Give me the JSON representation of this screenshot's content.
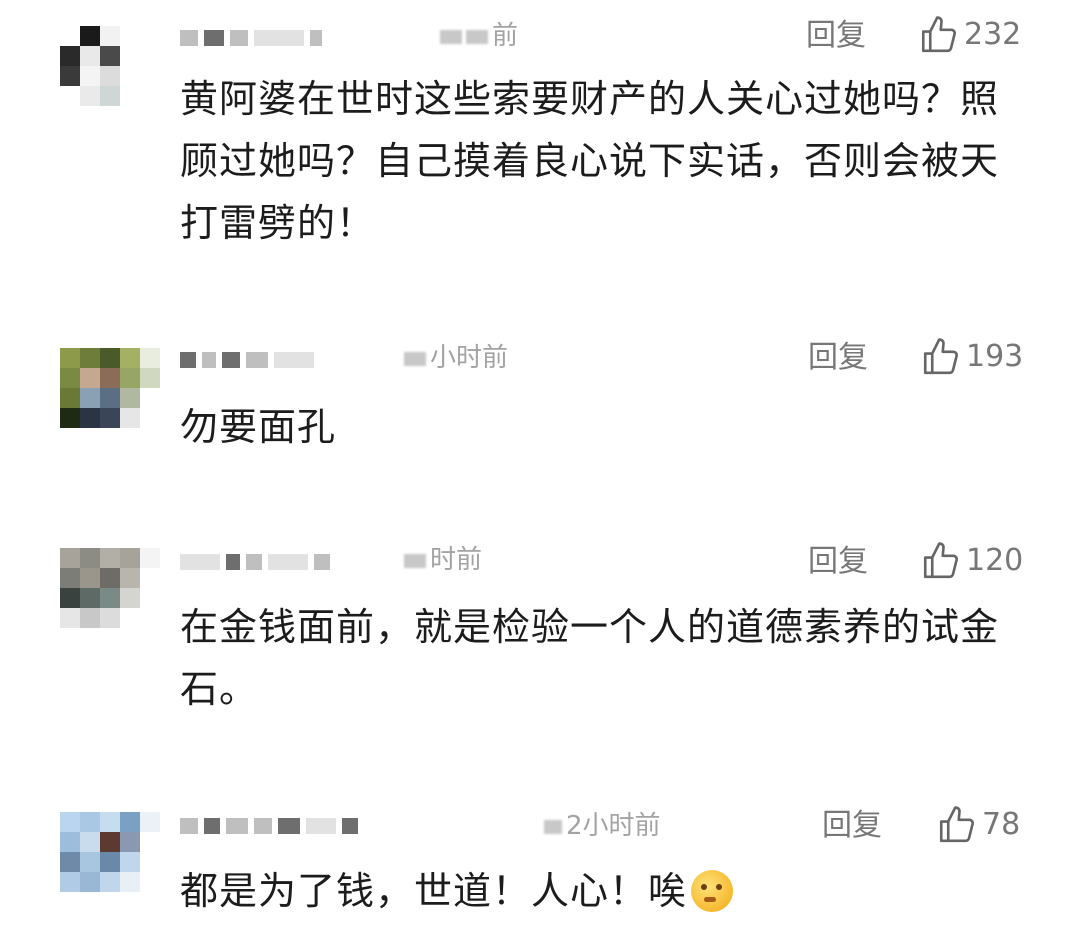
{
  "comments": [
    {
      "time": "前",
      "reply_label": "回复",
      "likes": "232",
      "text": "黄阿婆在世时这些索要财产的人关心过她吗？照顾过她吗？自己摸着良心说下实话，否则会被天打雷劈的！"
    },
    {
      "time": "小时前",
      "reply_label": "回复",
      "likes": "193",
      "text": "勿要面孔"
    },
    {
      "time": "时前",
      "reply_label": "回复",
      "likes": "120",
      "text": "在金钱面前，就是检验一个人的道德素养的试金石。"
    },
    {
      "time": "2小时前",
      "reply_label": "回复",
      "likes": "78",
      "text": "都是为了钱，世道！人心！唉",
      "emoji": "sweating-face-emoji"
    }
  ],
  "icons": {
    "like": "thumbs-up-icon"
  },
  "colors": {
    "text": "#1c1c1c",
    "meta": "#777777",
    "time": "#a3a3a3"
  }
}
